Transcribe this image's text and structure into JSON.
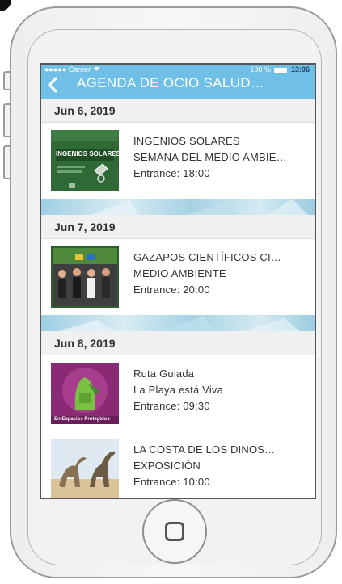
{
  "status_bar": {
    "carrier": "●●●●● Carrier",
    "wifi_icon": "wifi-icon",
    "battery_percent": "100 %",
    "time": "13:06"
  },
  "nav": {
    "back_icon": "back-chevron-icon",
    "title": "AGENDA DE OCIO SALUD…"
  },
  "sections": [
    {
      "date": "Jun 6, 2019",
      "events": [
        {
          "title": "INGENIOS SOLARES",
          "subtitle": "SEMANA DEL MEDIO AMBIE…",
          "entrance": "Entrance: 18:00",
          "thumb_text": "INGENIOS SOLARES"
        }
      ]
    },
    {
      "date": "Jun 7, 2019",
      "events": [
        {
          "title": "GAZAPOS CIENTÍFICOS CI…",
          "subtitle": "MEDIO AMBIENTE",
          "entrance": "Entrance: 20:00",
          "thumb_text": ""
        }
      ]
    },
    {
      "date": "Jun 8, 2019",
      "events": [
        {
          "title": "Ruta Guiada",
          "subtitle": "La Playa está Viva",
          "entrance": "Entrance: 09:30",
          "thumb_text": "En Espacios Protegidos"
        },
        {
          "title": "LA COSTA DE LOS DINOS…",
          "subtitle": "EXPOSICIÓN",
          "entrance": "Entrance: 10:00",
          "thumb_text": ""
        }
      ]
    }
  ]
}
